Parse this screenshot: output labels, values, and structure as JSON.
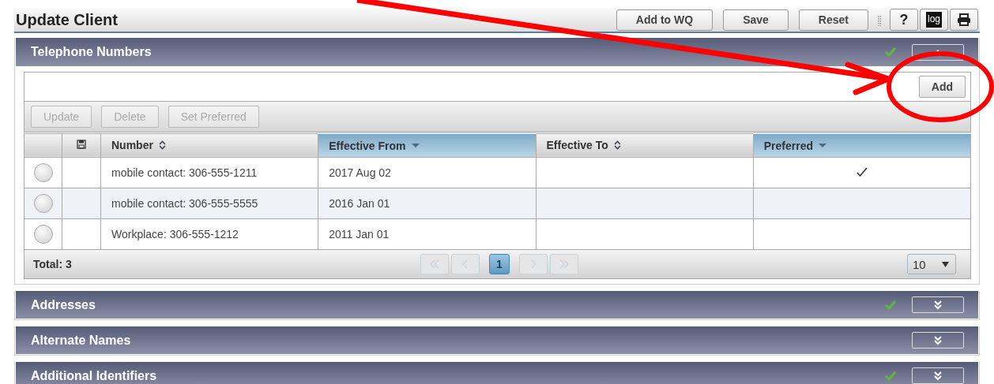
{
  "header": {
    "title": "Update Client",
    "buttons": [
      "Add to WQ",
      "Save",
      "Reset"
    ],
    "help": "?",
    "log": "log"
  },
  "sections": [
    {
      "title": "Telephone Numbers",
      "complete": true,
      "expanded": true
    },
    {
      "title": "Addresses",
      "complete": true,
      "expanded": false
    },
    {
      "title": "Alternate Names",
      "complete": false,
      "expanded": false
    },
    {
      "title": "Additional Identifiers",
      "complete": true,
      "expanded": false
    }
  ],
  "phones": {
    "add": "Add",
    "actions": [
      {
        "label": "Update",
        "disabled": true
      },
      {
        "label": "Delete",
        "disabled": true
      },
      {
        "label": "Set Preferred",
        "disabled": true
      }
    ],
    "columns": [
      {
        "label": "Number",
        "kind": "sortable"
      },
      {
        "label": "Effective From",
        "kind": "sorted"
      },
      {
        "label": "Effective To",
        "kind": "sortable"
      },
      {
        "label": "Preferred",
        "kind": "sorted"
      }
    ],
    "rows": [
      {
        "number": "mobile contact: 306-555-1211",
        "from": "2017 Aug 02",
        "selected": false,
        "preferred": true
      },
      {
        "number": "mobile contact: 306-555-5555",
        "from": "2016 Jan 01",
        "selected": false,
        "preferred": false
      },
      {
        "number": "Workplace: 306-555-1212",
        "from": "2011 Jan 01",
        "selected": false,
        "preferred": false
      }
    ],
    "total": "Total: 3",
    "page": "1",
    "page_size": "10"
  }
}
